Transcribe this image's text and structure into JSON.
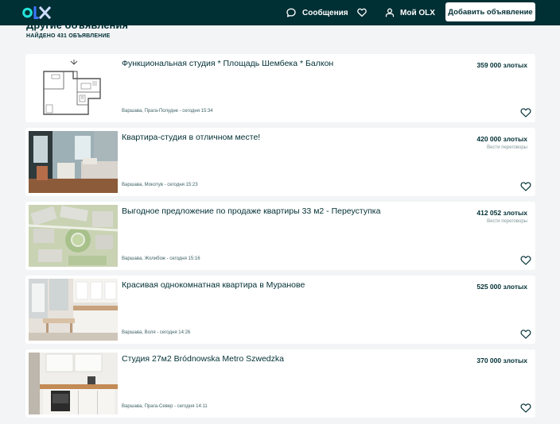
{
  "header": {
    "logo_text": "OLX",
    "messages_label": "Сообщения",
    "account_label": "Мой OLX",
    "post_button_label": "Добавить объявление"
  },
  "section": {
    "title": "Другие объявления",
    "found_count": "НАЙДЕНО 431 ОБЪЯВЛЕНИЕ"
  },
  "listings": [
    {
      "title": "Функциональная студия * Площадь Шембека * Балкон",
      "price": "359 000 злотых",
      "negotiable": "",
      "location": "Варшава, Прага-Полудне - сегодня 15:34",
      "thumb": "floor-plan"
    },
    {
      "title": "Квартира-студия в отличном месте!",
      "price": "420 000 злотых",
      "negotiable": "Вести переговоры",
      "location": "Варшава, Мокотув - сегодня 15:23",
      "thumb": "living-room"
    },
    {
      "title": "Выгодное предложение по продаже квартиры 33 м2 - Переуступка",
      "price": "412 052 злотых",
      "negotiable": "Вести переговоры",
      "location": "Варшава, Жолибож - сегодня 15:16",
      "thumb": "site-plan"
    },
    {
      "title": "Красивая однокомнатная квартира в Муранове",
      "price": "525 000 злотых",
      "negotiable": "",
      "location": "Варшава, Воля - сегодня 14:26",
      "thumb": "kitchen-white"
    },
    {
      "title": "Студия 27м2 Bródnowska Metro Szwedzka",
      "price": "370 000 злотых",
      "negotiable": "",
      "location": "Варшава, Прага-Север - сегодня 14:11",
      "thumb": "kitchen-wood"
    }
  ],
  "colors": {
    "header_bg": "#002f34",
    "page_bg": "#f2f4f5",
    "text": "#002f34",
    "muted": "#7f9799",
    "logo_o": "#23e5db",
    "logo_l": "#3a77ff",
    "logo_x": "#ceddff"
  },
  "icons": [
    "chat-icon",
    "heart-icon",
    "user-icon"
  ]
}
